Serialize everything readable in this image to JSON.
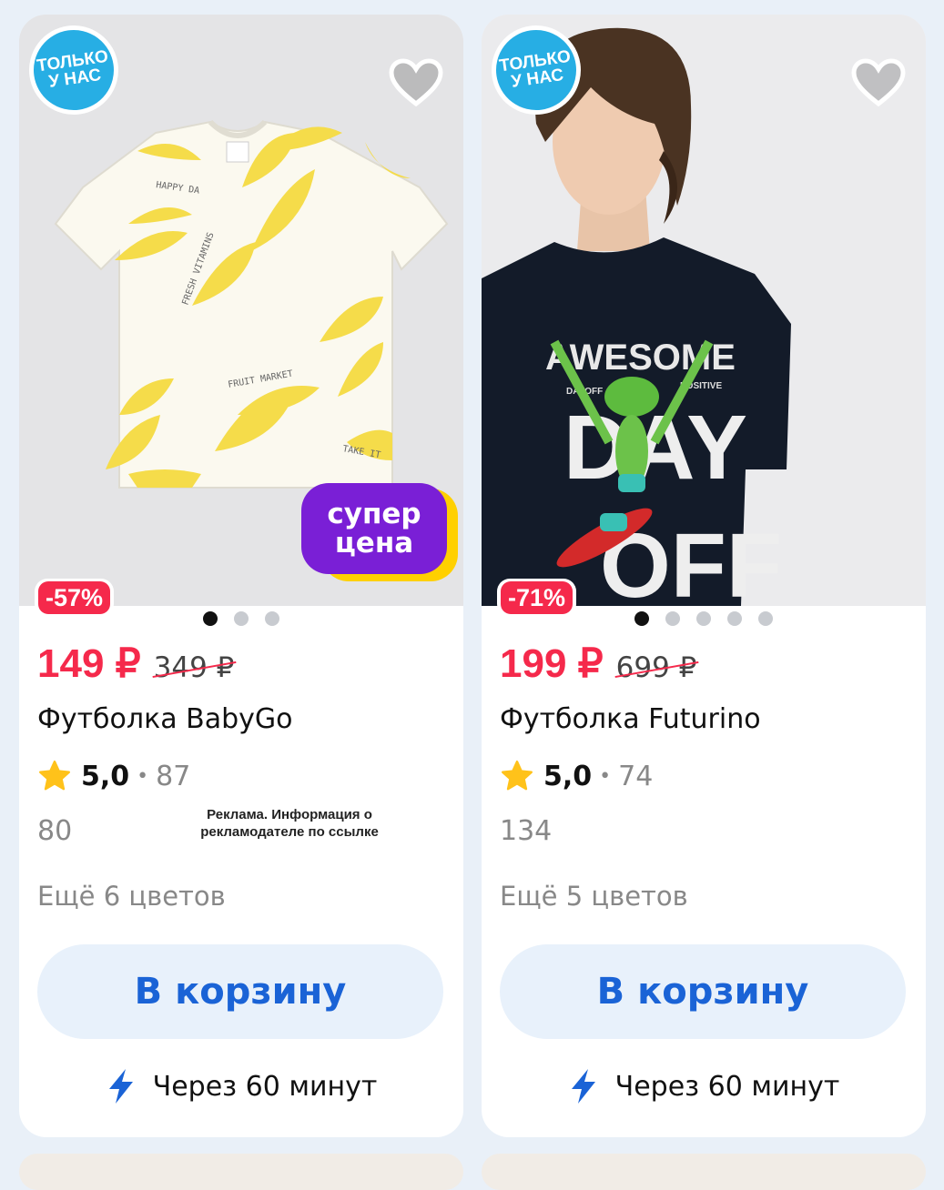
{
  "products": [
    {
      "badge": "ТОЛЬКО\nУ НАС",
      "discount": "-57%",
      "promo_badge": "супер\nцена",
      "price": "149 ₽",
      "old_price": "349 ₽",
      "title": "Футболка BabyGo",
      "rating": "5,0",
      "reviews": "87",
      "count": "80",
      "ad_note": "Реклама. Информация о рекламодателе по ссылке",
      "colors": "Ещё 6 цветов",
      "cart": "В корзину",
      "delivery": "Через 60 минут",
      "photos": 3
    },
    {
      "badge": "ТОЛЬКО\nУ НАС",
      "discount": "-71%",
      "price": "199 ₽",
      "old_price": "699 ₽",
      "title": "Футболка Futurino",
      "rating": "5,0",
      "reviews": "74",
      "count": "134",
      "colors": "Ещё 5 цветов",
      "cart": "В корзину",
      "delivery": "Через 60 минут",
      "photos": 5,
      "shirt_print": {
        "top": "AWESOME",
        "line1_left": "DAYOFF",
        "line1_right": "POSITIVE",
        "big1": "DAY",
        "big2": "OFF"
      }
    }
  ],
  "colors": {
    "accent_red": "#f5294b",
    "button_blue": "#1a63d6",
    "badge_blue": "#27aee4",
    "promo_purple": "#7a1fd6",
    "promo_yellow": "#ffd000",
    "star_yellow": "#ffc21a"
  }
}
